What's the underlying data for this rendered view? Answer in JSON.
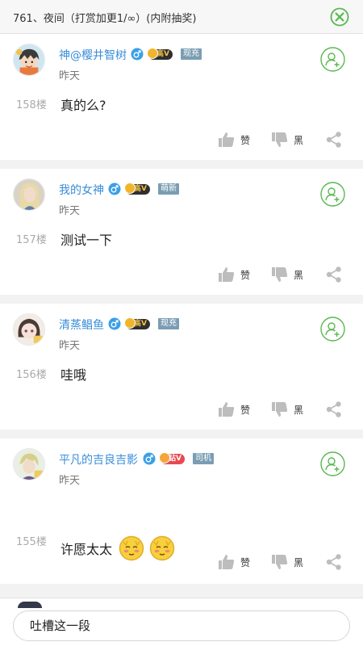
{
  "header": {
    "title": "761、夜间（打赏加更1/∞）(内附抽奖)"
  },
  "colors": {
    "accent_green": "#59b84f",
    "username_blue": "#3a8dd8",
    "floor_gray": "#aaaaaa"
  },
  "action_labels": {
    "like": "赞",
    "dislike": "黑"
  },
  "comments": [
    {
      "username": "神@樱井智树",
      "vip": "高V",
      "tag": "现充",
      "time": "昨天",
      "floor": "158楼",
      "text": "真的么?"
    },
    {
      "username": "我的女神",
      "vip": "高V",
      "tag": "萌新",
      "time": "昨天",
      "floor": "157楼",
      "text": "测试一下"
    },
    {
      "username": "清蒸鲳鱼",
      "vip": "高V",
      "tag": "现充",
      "time": "昨天",
      "floor": "156楼",
      "text": "哇哦"
    },
    {
      "username": "平凡的吉良吉影",
      "vip": "钻V",
      "tag": "司机",
      "time": "昨天",
      "floor": "155楼",
      "text": "许愿太太",
      "emojis": [
        "blush-emoji",
        "blush-emoji"
      ]
    }
  ],
  "reply": {
    "placeholder": "吐槽这一段"
  }
}
